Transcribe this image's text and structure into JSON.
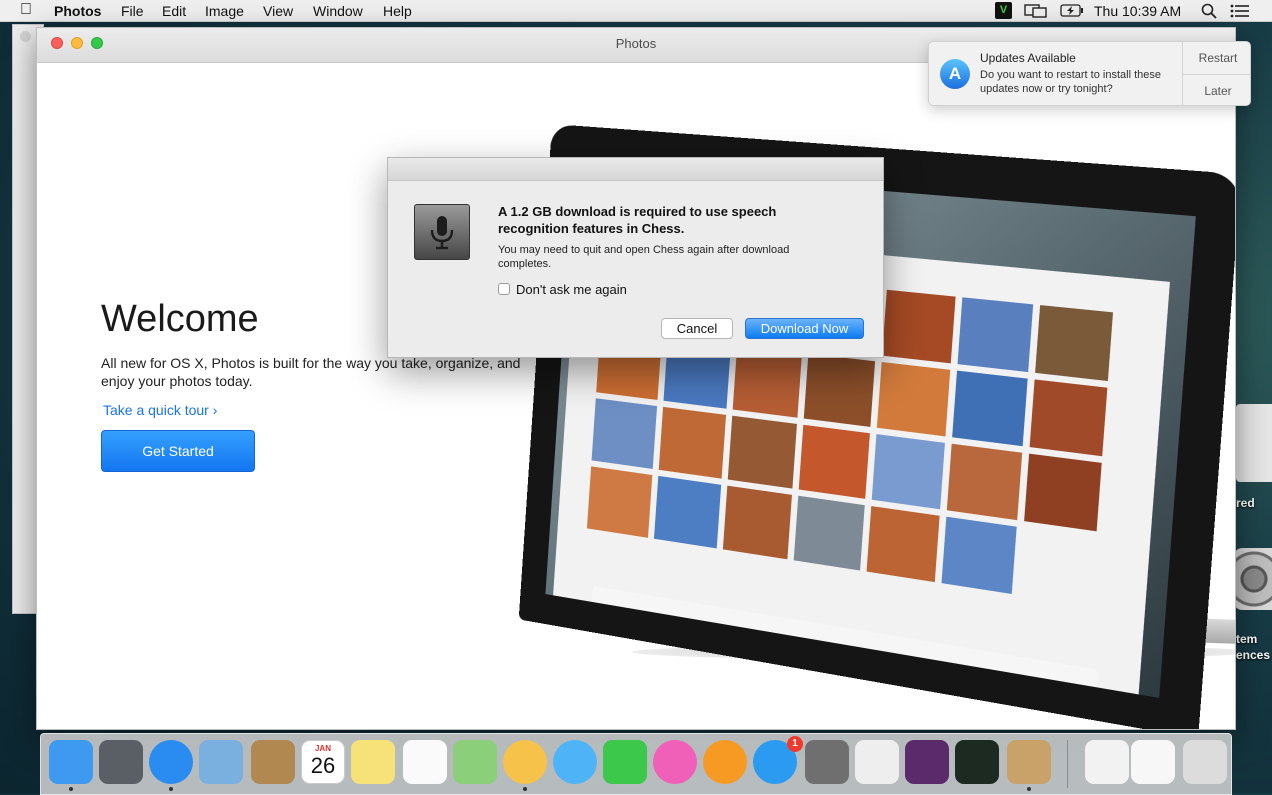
{
  "menubar": {
    "apple": "",
    "app_name": "Photos",
    "menus": [
      "File",
      "Edit",
      "Image",
      "View",
      "Window",
      "Help"
    ],
    "vc_label": "V",
    "clock": "Thu 10:39 AM"
  },
  "photos_window": {
    "title": "Photos",
    "welcome_title": "Welcome",
    "welcome_body": "All new for OS X, Photos is built for the way you take, organize, and enjoy your photos today.",
    "tour_link": "Take a quick tour ›",
    "get_started": "Get Started"
  },
  "dialog": {
    "heading": "A 1.2 GB download is required to use speech recognition features in Chess.",
    "body": "You may need to quit and open Chess again after download completes.",
    "checkbox_label": "Don't ask me again",
    "checkbox_checked": false,
    "cancel_label": "Cancel",
    "download_label": "Download Now"
  },
  "notification": {
    "title": "Updates Available",
    "body": "Do you want to restart to install these updates now or try tonight?",
    "restart_label": "Restart",
    "later_label": "Later",
    "icon_glyph": "A"
  },
  "desktop": {
    "label_1": "red",
    "label_2": "tem",
    "label_3": "ences"
  },
  "dock": {
    "items": [
      {
        "name": "finder-icon",
        "color": "#3e9af0",
        "running": true
      },
      {
        "name": "launchpad-icon",
        "color": "#5a5f66",
        "running": false
      },
      {
        "name": "safari-icon",
        "color": "#2a8cf0",
        "running": true
      },
      {
        "name": "mail-icon",
        "color": "#7ab0e0",
        "running": false
      },
      {
        "name": "contacts-icon",
        "color": "#b08850",
        "running": false
      },
      {
        "name": "calendar-icon",
        "color": "#ffffff",
        "running": false
      },
      {
        "name": "notes-icon",
        "color": "#f7e27a",
        "running": false
      },
      {
        "name": "reminders-icon",
        "color": "#fafafa",
        "running": false
      },
      {
        "name": "maps-icon",
        "color": "#8ccf7a",
        "running": false
      },
      {
        "name": "photos-icon",
        "color": "#f6c24a",
        "running": true
      },
      {
        "name": "messages-icon",
        "color": "#4fb3f7",
        "running": false
      },
      {
        "name": "facetime-icon",
        "color": "#3cc84a",
        "running": false
      },
      {
        "name": "itunes-icon",
        "color": "#f05fb8",
        "running": false
      },
      {
        "name": "ibooks-icon",
        "color": "#f79a24",
        "running": false
      },
      {
        "name": "app-store-icon",
        "color": "#2b9bf2",
        "running": false
      },
      {
        "name": "system-preferences-icon",
        "color": "#6f6f6f",
        "running": false
      },
      {
        "name": "textedit-icon",
        "color": "#eeeeee",
        "running": false
      },
      {
        "name": "eggplant-icon",
        "color": "#5a2a6a",
        "running": false
      },
      {
        "name": "activity-monitor-icon",
        "color": "#1d2a22",
        "running": false
      },
      {
        "name": "chess-icon",
        "color": "#c9a26a",
        "running": true
      },
      {
        "name": "downloads-stack-icon",
        "color": "#f2f2f2",
        "running": false
      },
      {
        "name": "documents-stack-icon",
        "color": "#f7f7f7",
        "running": false
      },
      {
        "name": "trash-icon",
        "color": "#dcdcdc",
        "running": false
      }
    ],
    "calendar": {
      "month": "JAN",
      "day": "26"
    },
    "app_store_badge": "1"
  }
}
